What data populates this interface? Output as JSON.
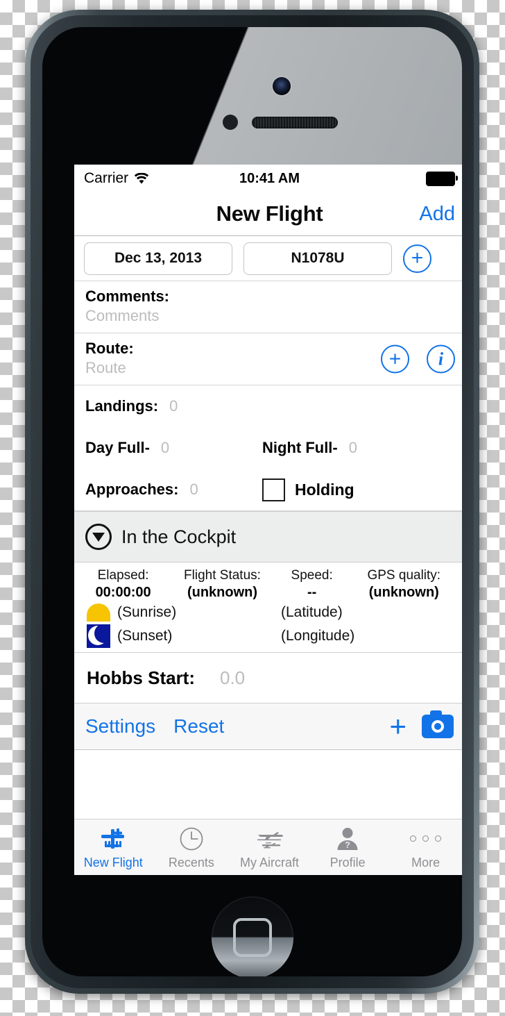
{
  "statusbar": {
    "carrier": "Carrier",
    "wifi_icon": "wifi-icon",
    "time": "10:41 AM",
    "battery_icon": "battery-full-icon"
  },
  "navbar": {
    "title": "New Flight",
    "add_label": "Add"
  },
  "form": {
    "date_value": "Dec 13, 2013",
    "tail_value": "N1078U",
    "add_aircraft_icon": "plus-circle-icon",
    "comments_label": "Comments:",
    "comments_placeholder": "Comments",
    "route_label": "Route:",
    "route_placeholder": "Route",
    "route_add_icon": "plus-circle-icon",
    "route_info_icon": "info-circle-icon",
    "landings_label": "Landings:",
    "landings_value": "0",
    "day_full_label": "Day Full-",
    "day_full_value": "0",
    "night_full_label": "Night Full-",
    "night_full_value": "0",
    "approaches_label": "Approaches:",
    "approaches_value": "0",
    "holding_label": "Holding"
  },
  "cockpit": {
    "disclosure_icon": "triangle-down-circle-icon",
    "title": "In the Cockpit",
    "elapsed_label": "Elapsed:",
    "elapsed_value": "00:00:00",
    "status_label": "Flight Status:",
    "status_value": "(unknown)",
    "speed_label": "Speed:",
    "speed_value": "--",
    "gps_label": "GPS quality:",
    "gps_value": "(unknown)",
    "sunrise_icon": "sun-icon",
    "sunrise_text": "(Sunrise)",
    "sunset_icon": "moon-icon",
    "sunset_text": "(Sunset)",
    "latitude_text": "(Latitude)",
    "longitude_text": "(Longitude)"
  },
  "hobbs": {
    "label": "Hobbs Start:",
    "value": "0.0"
  },
  "toolbar": {
    "settings_label": "Settings",
    "reset_label": "Reset",
    "add_icon": "plus-icon",
    "camera_icon": "camera-icon"
  },
  "tabbar": {
    "items": [
      {
        "label": "New Flight",
        "icon": "airplane-plus-icon"
      },
      {
        "label": "Recents",
        "icon": "clock-icon"
      },
      {
        "label": "My Aircraft",
        "icon": "aircraft-icon"
      },
      {
        "label": "Profile",
        "icon": "person-question-icon"
      },
      {
        "label": "More",
        "icon": "ellipsis-icon"
      }
    ]
  },
  "colors": {
    "accent": "#1273e8",
    "placeholder": "#bcbcbc",
    "tab_inactive": "#8e8e93",
    "sun": "#f6c400",
    "moon_bg": "#0a189b"
  }
}
